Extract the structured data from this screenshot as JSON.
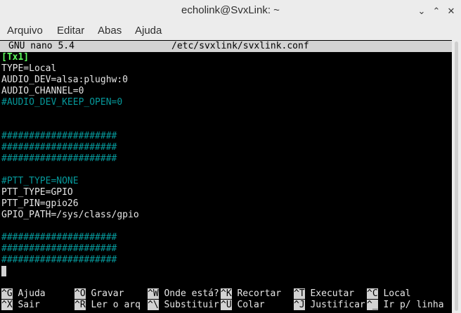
{
  "window": {
    "title": "echolink@SvxLink: ~"
  },
  "menubar": {
    "items": [
      "Arquivo",
      "Editar",
      "Abas",
      "Ajuda"
    ]
  },
  "nano": {
    "version": "GNU nano 5.4",
    "filename": "/etc/svxlink/svxlink.conf",
    "lines": [
      "[Tx1]",
      "TYPE=Local",
      "AUDIO_DEV=alsa:plughw:0",
      "AUDIO_CHANNEL=0",
      "#AUDIO_DEV_KEEP_OPEN=0",
      "",
      "",
      "#####################",
      "#####################",
      "#####################",
      "",
      "#PTT_TYPE=NONE",
      "PTT_TYPE=GPIO",
      "PTT_PIN=gpio26",
      "GPIO_PATH=/sys/class/gpio",
      "",
      "#####################",
      "#####################",
      "#####################"
    ],
    "shortcuts_row1": [
      {
        "key": "^G",
        "label": "Ajuda"
      },
      {
        "key": "^O",
        "label": "Gravar"
      },
      {
        "key": "^W",
        "label": "Onde está?"
      },
      {
        "key": "^K",
        "label": "Recortar"
      },
      {
        "key": "^T",
        "label": "Executar"
      },
      {
        "key": "^C",
        "label": "Local"
      }
    ],
    "shortcuts_row2": [
      {
        "key": "^X",
        "label": "Sair"
      },
      {
        "key": "^R",
        "label": "Ler o arq"
      },
      {
        "key": "^\\",
        "label": "Substituir"
      },
      {
        "key": "^U",
        "label": "Colar"
      },
      {
        "key": "^J",
        "label": "Justificar"
      },
      {
        "key": "^_",
        "label": "Ir p/ linha"
      }
    ]
  }
}
